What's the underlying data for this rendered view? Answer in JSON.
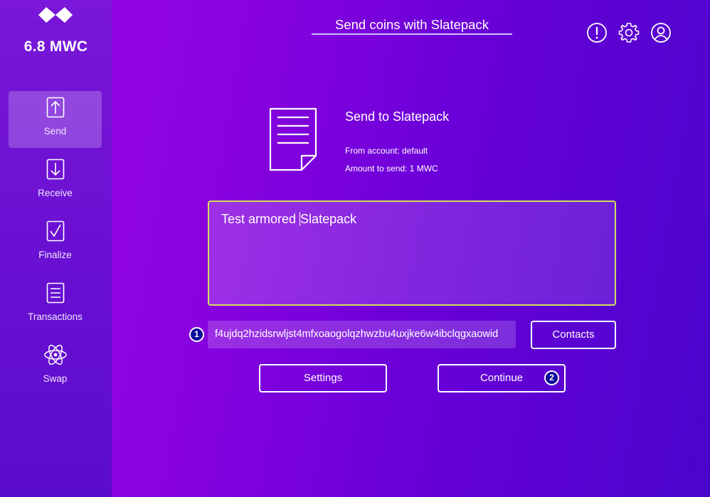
{
  "sidebar": {
    "balance": "6.8 MWC",
    "items": [
      {
        "label": "Send",
        "icon": "send-icon",
        "active": true
      },
      {
        "label": "Receive",
        "icon": "receive-icon",
        "active": false
      },
      {
        "label": "Finalize",
        "icon": "finalize-icon",
        "active": false
      },
      {
        "label": "Transactions",
        "icon": "transactions-icon",
        "active": false
      },
      {
        "label": "Swap",
        "icon": "swap-icon",
        "active": false
      }
    ]
  },
  "header": {
    "title": "Send coins with Slatepack",
    "icons": [
      "info-icon",
      "gear-icon",
      "account-icon"
    ]
  },
  "send": {
    "title": "Send to Slatepack",
    "from_account": "From account: default",
    "amount": "Amount to send: 1 MWC"
  },
  "slatepack": {
    "text_before_cursor": "Test armored ",
    "text_after_cursor": "Slatepack"
  },
  "address": {
    "badge": "1",
    "value": "f4ujdq2hzidsrwljst4mfxoaogolqzhwzbu4uxjke6w4ibclqgxaowid"
  },
  "buttons": {
    "contacts": "Contacts",
    "settings": "Settings",
    "continue": "Continue",
    "continue_badge": "2"
  },
  "colors": {
    "active_border": "#cfe05a",
    "badge_fill": "#0a0a9a"
  }
}
